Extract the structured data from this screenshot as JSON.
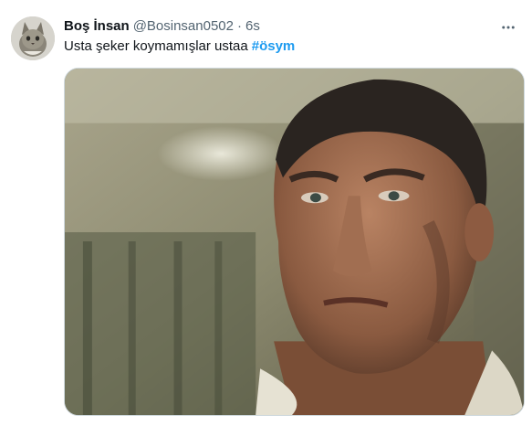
{
  "tweet": {
    "display_name": "Boş İnsan",
    "handle": "@Bosinsan0502",
    "separator": "·",
    "time": "6s",
    "more_icon": "more-horizontal-icon",
    "text": "Usta şeker koymamışlar ustaa",
    "hashtag": "#ösym",
    "hashtag_color": "#1d9bf0",
    "media_description_icon": "photo-image"
  }
}
